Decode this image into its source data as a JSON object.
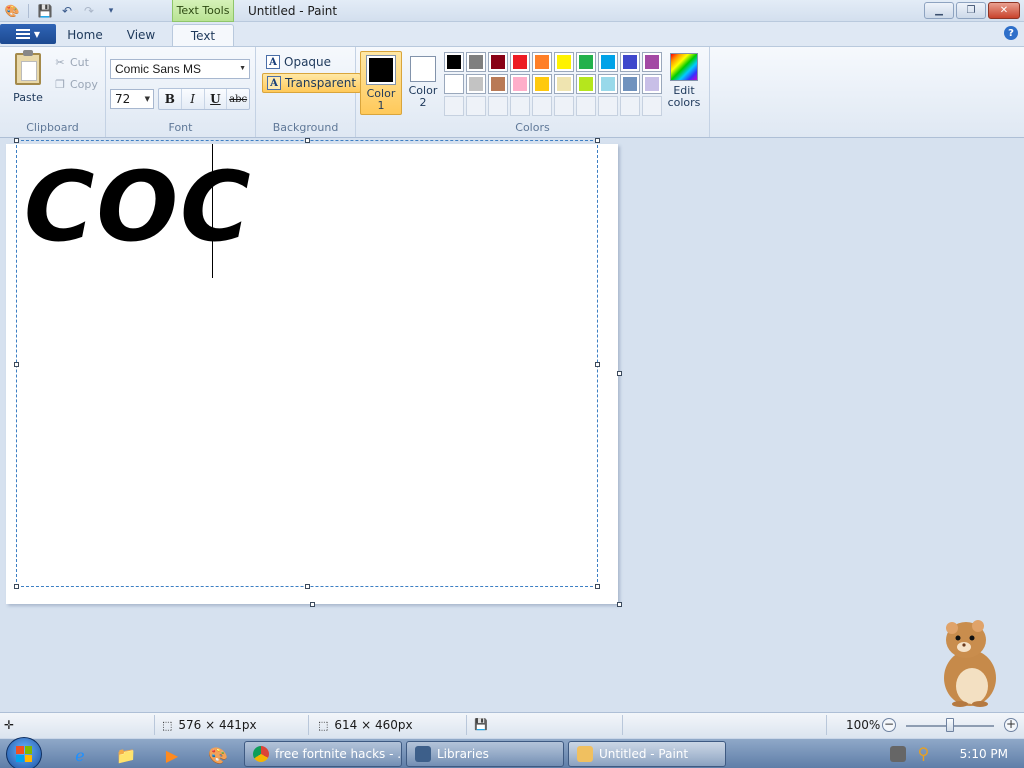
{
  "window": {
    "title": "Untitled - Paint",
    "contextual_tab": "Text Tools"
  },
  "tabs": {
    "home": "Home",
    "view": "View",
    "text": "Text"
  },
  "clipboard": {
    "paste": "Paste",
    "cut": "Cut",
    "copy": "Copy",
    "group_label": "Clipboard"
  },
  "font": {
    "family": "Comic Sans MS",
    "size": "72",
    "bold": "B",
    "italic": "I",
    "underline": "U",
    "strike": "abc",
    "group_label": "Font"
  },
  "background": {
    "opaque": "Opaque",
    "transparent": "Transparent",
    "group_label": "Background",
    "selected": "Transparent"
  },
  "colors": {
    "color1_label": "Color 1",
    "color2_label": "Color 2",
    "edit_colors": "Edit colors",
    "group_label": "Colors",
    "color1": "#000000",
    "color2": "#ffffff",
    "palette_row1": [
      "#000000",
      "#7f7f7f",
      "#880015",
      "#ed1c24",
      "#ff7f27",
      "#fff200",
      "#22b14c",
      "#00a2e8",
      "#3f48cc",
      "#a349a4"
    ],
    "palette_row2": [
      "#ffffff",
      "#c3c3c3",
      "#b97a57",
      "#ffaec9",
      "#ffc90e",
      "#efe4b0",
      "#b5e61d",
      "#99d9ea",
      "#7092be",
      "#c8bfe7"
    ]
  },
  "canvas": {
    "text": "COC"
  },
  "statusbar": {
    "selection_size": "576 × 441px",
    "canvas_size": "614 × 460px",
    "zoom": "100%"
  },
  "taskbar": {
    "items": [
      {
        "label": "free fortnite hacks - ..."
      },
      {
        "label": "Libraries"
      },
      {
        "label": "Untitled - Paint"
      }
    ],
    "clock": "5:10 PM"
  }
}
